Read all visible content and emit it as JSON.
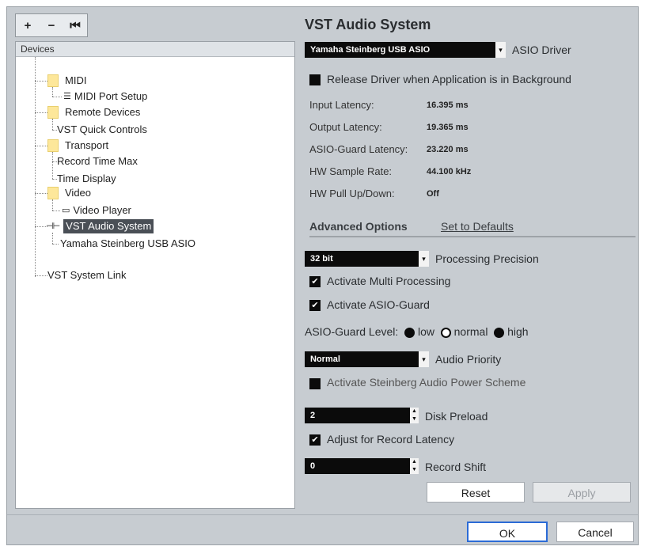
{
  "toolbar": {
    "add": "+",
    "remove": "−",
    "reset_device": "⏮"
  },
  "tree": {
    "header": "Devices",
    "items": [
      {
        "label": "MIDI"
      },
      {
        "label": "MIDI Port Setup"
      },
      {
        "label": "Remote Devices"
      },
      {
        "label": "VST Quick Controls"
      },
      {
        "label": "Transport"
      },
      {
        "label": "Record Time Max"
      },
      {
        "label": "Time Display"
      },
      {
        "label": "Video"
      },
      {
        "label": "Video Player"
      },
      {
        "label": "VST Audio System"
      },
      {
        "label": "Yamaha Steinberg USB ASIO"
      },
      {
        "label": "VST System Link"
      }
    ]
  },
  "panel": {
    "title": "VST Audio System",
    "asio_driver": {
      "value": "Yamaha Steinberg USB ASIO",
      "label": "ASIO Driver"
    },
    "release_driver_label": "Release Driver when Application is in Background",
    "info": [
      {
        "label": "Input Latency:",
        "value": "16.395 ms"
      },
      {
        "label": "Output Latency:",
        "value": "19.365 ms"
      },
      {
        "label": "ASIO-Guard Latency:",
        "value": "23.220 ms"
      },
      {
        "label": "HW Sample Rate:",
        "value": "44.100 kHz"
      },
      {
        "label": "HW Pull Up/Down:",
        "value": "Off"
      }
    ],
    "advanced_options": "Advanced Options",
    "set_to_defaults": "Set to Defaults",
    "processing_precision": {
      "value": "32 bit",
      "label": "Processing Precision"
    },
    "multi_processing_label": "Activate Multi Processing",
    "asio_guard_label": "Activate ASIO-Guard",
    "asio_guard_level": {
      "label": "ASIO-Guard Level:",
      "low": "low",
      "normal": "normal",
      "high": "high"
    },
    "audio_priority": {
      "value": "Normal",
      "label": "Audio Priority"
    },
    "power_scheme_label": "Activate Steinberg Audio Power Scheme",
    "disk_preload": {
      "value": "2",
      "label": "Disk Preload"
    },
    "adjust_latency_label": "Adjust for Record Latency",
    "record_shift": {
      "value": "0",
      "label": "Record Shift"
    },
    "reset": "Reset",
    "apply": "Apply"
  },
  "footer": {
    "ok": "OK",
    "cancel": "Cancel"
  },
  "icons": {
    "checkbox_checked": "✔",
    "dropdown_arrow": "▾",
    "stepper_up": "▲",
    "stepper_down": "▼",
    "midi_port": "☰",
    "video_player": "▭",
    "vst_audio": "⊣⊢"
  }
}
